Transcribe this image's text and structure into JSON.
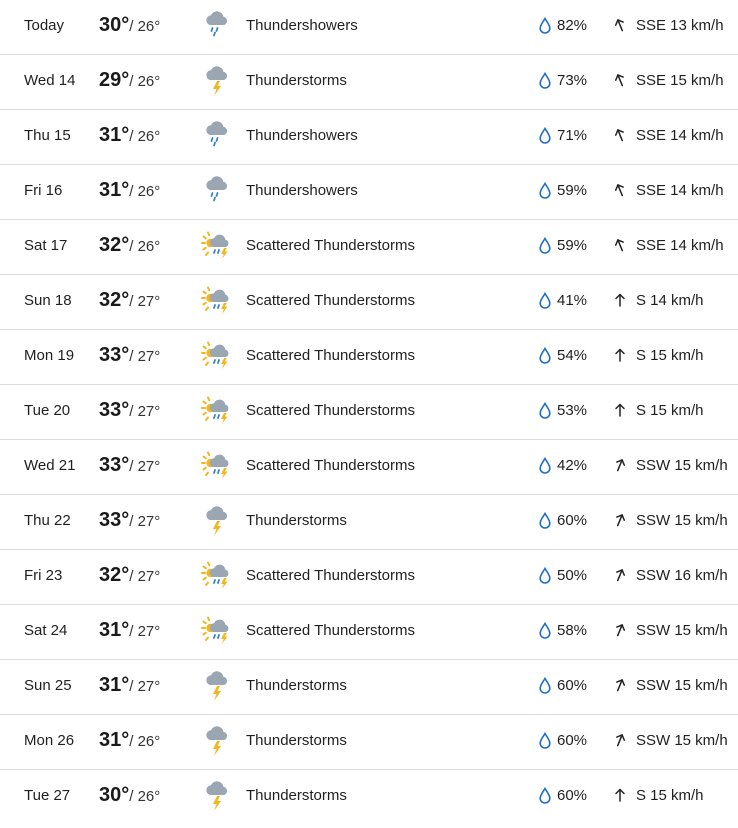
{
  "forecast": {
    "rows": [
      {
        "day": "Today",
        "high": "30°",
        "low": "/ 26°",
        "icon": "thundershowers-icon",
        "condition": "Thundershowers",
        "precip": "82%",
        "wind": "SSE 13 km/h",
        "wind_dir": "SSE"
      },
      {
        "day": "Wed 14",
        "high": "29°",
        "low": "/ 26°",
        "icon": "thunderstorms-icon",
        "condition": "Thunderstorms",
        "precip": "73%",
        "wind": "SSE 15 km/h",
        "wind_dir": "SSE"
      },
      {
        "day": "Thu 15",
        "high": "31°",
        "low": "/ 26°",
        "icon": "thundershowers-icon",
        "condition": "Thundershowers",
        "precip": "71%",
        "wind": "SSE 14 km/h",
        "wind_dir": "SSE"
      },
      {
        "day": "Fri 16",
        "high": "31°",
        "low": "/ 26°",
        "icon": "thundershowers-icon",
        "condition": "Thundershowers",
        "precip": "59%",
        "wind": "SSE 14 km/h",
        "wind_dir": "SSE"
      },
      {
        "day": "Sat 17",
        "high": "32°",
        "low": "/ 26°",
        "icon": "scattered-thunderstorms-icon",
        "condition": "Scattered Thunderstorms",
        "precip": "59%",
        "wind": "SSE 14 km/h",
        "wind_dir": "SSE"
      },
      {
        "day": "Sun 18",
        "high": "32°",
        "low": "/ 27°",
        "icon": "scattered-thunderstorms-icon",
        "condition": "Scattered Thunderstorms",
        "precip": "41%",
        "wind": "S 14 km/h",
        "wind_dir": "S"
      },
      {
        "day": "Mon 19",
        "high": "33°",
        "low": "/ 27°",
        "icon": "scattered-thunderstorms-icon",
        "condition": "Scattered Thunderstorms",
        "precip": "54%",
        "wind": "S 15 km/h",
        "wind_dir": "S"
      },
      {
        "day": "Tue 20",
        "high": "33°",
        "low": "/ 27°",
        "icon": "scattered-thunderstorms-icon",
        "condition": "Scattered Thunderstorms",
        "precip": "53%",
        "wind": "S 15 km/h",
        "wind_dir": "S"
      },
      {
        "day": "Wed 21",
        "high": "33°",
        "low": "/ 27°",
        "icon": "scattered-thunderstorms-icon",
        "condition": "Scattered Thunderstorms",
        "precip": "42%",
        "wind": "SSW 15 km/h",
        "wind_dir": "SSW"
      },
      {
        "day": "Thu 22",
        "high": "33°",
        "low": "/ 27°",
        "icon": "thunderstorms-icon",
        "condition": "Thunderstorms",
        "precip": "60%",
        "wind": "SSW 15 km/h",
        "wind_dir": "SSW"
      },
      {
        "day": "Fri 23",
        "high": "32°",
        "low": "/ 27°",
        "icon": "scattered-thunderstorms-icon",
        "condition": "Scattered Thunderstorms",
        "precip": "50%",
        "wind": "SSW 16 km/h",
        "wind_dir": "SSW"
      },
      {
        "day": "Sat 24",
        "high": "31°",
        "low": "/ 27°",
        "icon": "scattered-thunderstorms-icon",
        "condition": "Scattered Thunderstorms",
        "precip": "58%",
        "wind": "SSW 15 km/h",
        "wind_dir": "SSW"
      },
      {
        "day": "Sun 25",
        "high": "31°",
        "low": "/ 27°",
        "icon": "thunderstorms-icon",
        "condition": "Thunderstorms",
        "precip": "60%",
        "wind": "SSW 15 km/h",
        "wind_dir": "SSW"
      },
      {
        "day": "Mon 26",
        "high": "31°",
        "low": "/ 26°",
        "icon": "thunderstorms-icon",
        "condition": "Thunderstorms",
        "precip": "60%",
        "wind": "SSW 15 km/h",
        "wind_dir": "SSW"
      },
      {
        "day": "Tue 27",
        "high": "30°",
        "low": "/ 26°",
        "icon": "thunderstorms-icon",
        "condition": "Thunderstorms",
        "precip": "60%",
        "wind": "S 15 km/h",
        "wind_dir": "S"
      }
    ]
  },
  "colors": {
    "cloud": "#9aa7b3",
    "rain": "#2f86c8",
    "bolt": "#f2b71f",
    "sun": "#f2b71f",
    "drop_outline": "#1f6fc4",
    "separator": "#dcdcdc"
  }
}
